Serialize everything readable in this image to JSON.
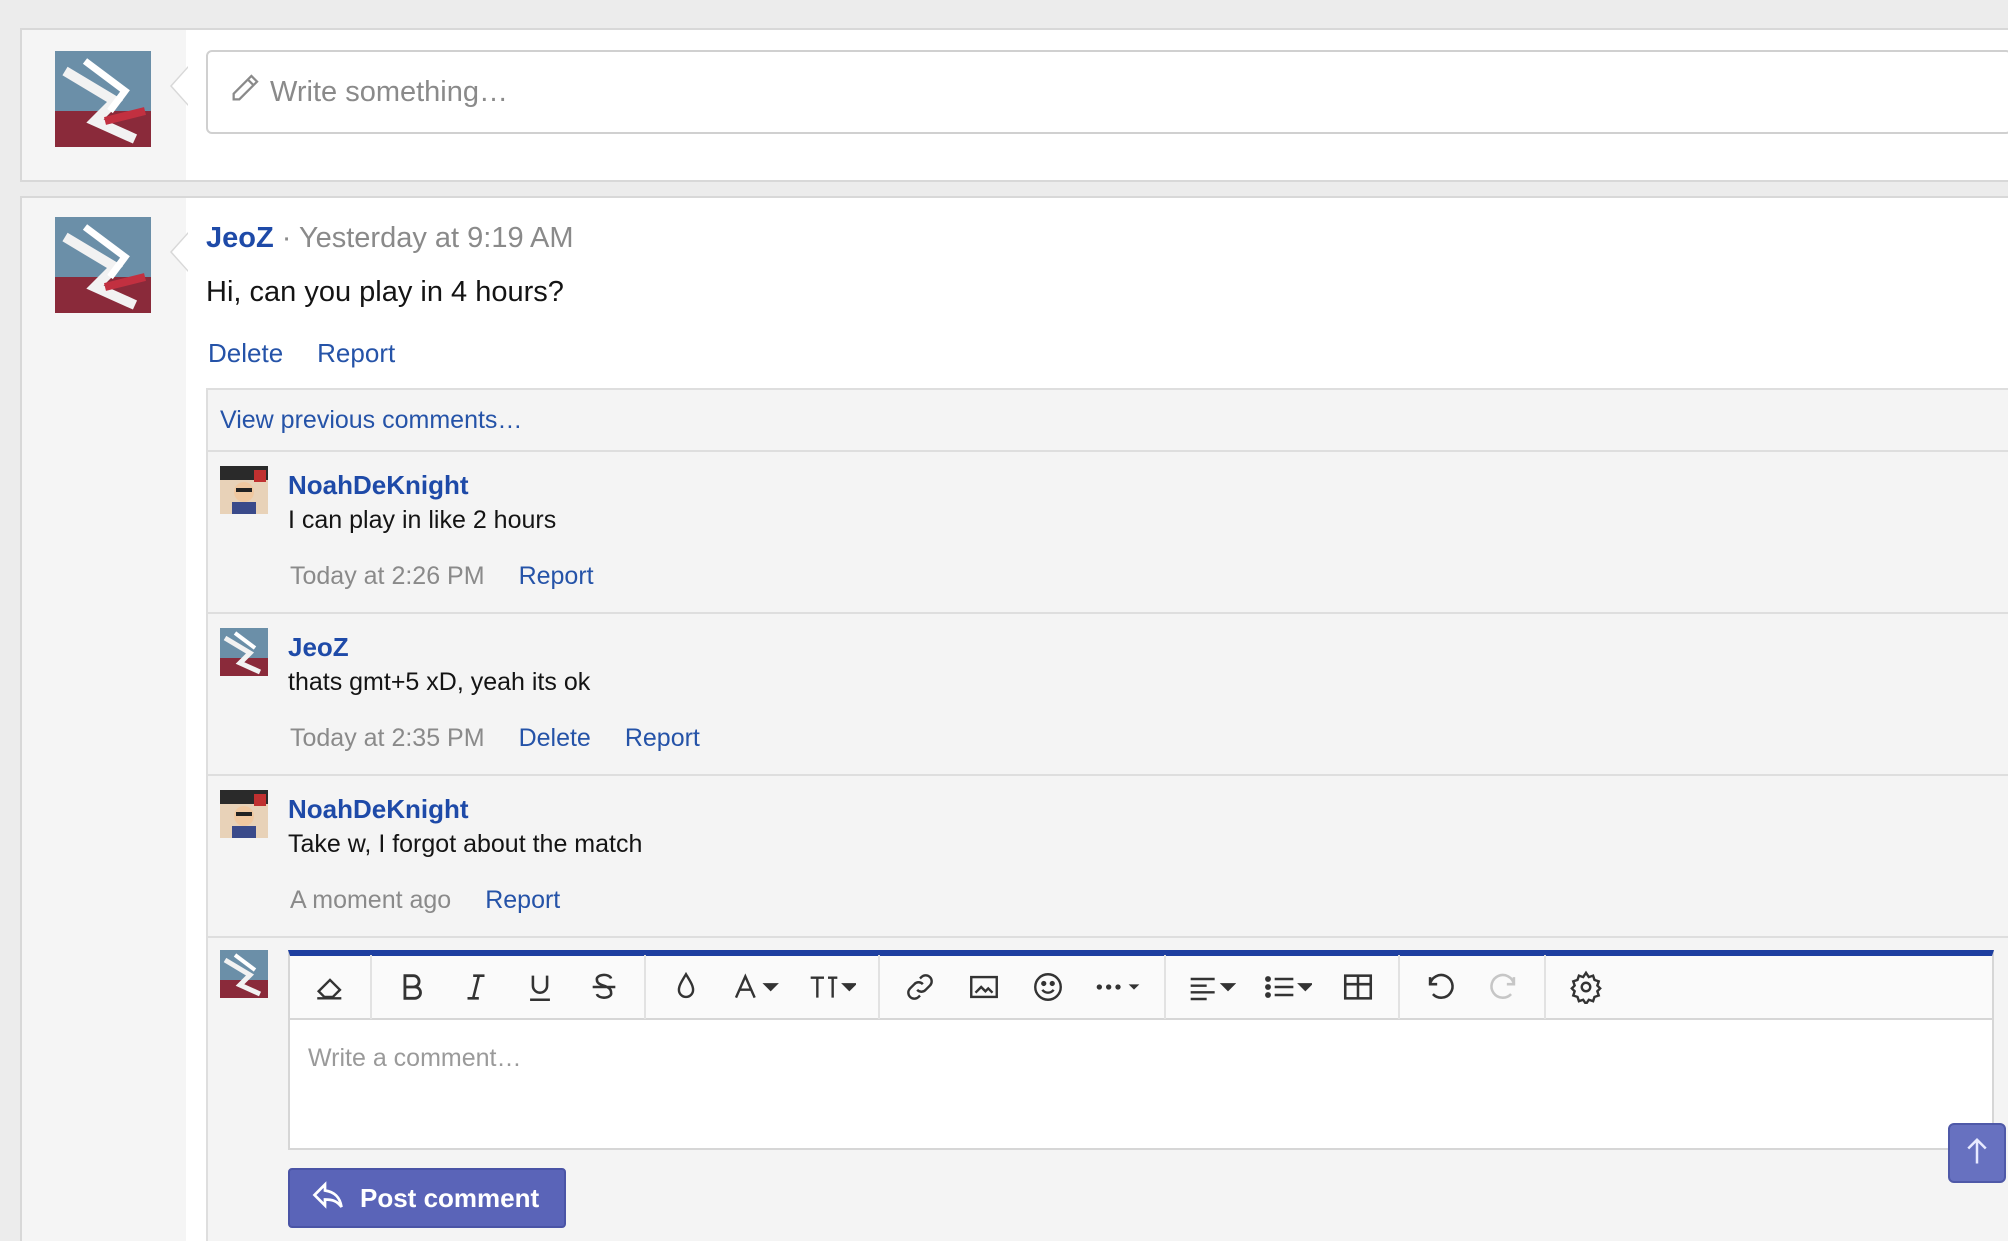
{
  "status_box": {
    "placeholder": "Write something…"
  },
  "post": {
    "author": "JeoZ",
    "separator": " · ",
    "time": "Yesterday at 9:19 AM",
    "body": "Hi, can you play in 4 hours?",
    "actions": {
      "delete": "Delete",
      "report": "Report"
    }
  },
  "comments": {
    "view_previous": "View previous comments…",
    "items": [
      {
        "author": "NoahDeKnight",
        "text": "I can play in like 2 hours",
        "time": "Today at 2:26 PM",
        "report": "Report"
      },
      {
        "author": "JeoZ",
        "text": "thats gmt+5 xD, yeah its ok",
        "time": "Today at 2:35 PM",
        "delete": "Delete",
        "report": "Report"
      },
      {
        "author": "NoahDeKnight",
        "text": "Take w, I forgot about the match",
        "time": "A moment ago",
        "report": "Report"
      }
    ]
  },
  "reply_editor": {
    "placeholder": "Write a comment…",
    "toolbar_icons": [
      "eraser-icon",
      "bold-icon",
      "italic-icon",
      "underline-icon",
      "strikethrough-icon",
      "text-color-icon",
      "font-family-icon",
      "font-size-icon",
      "link-icon",
      "image-icon",
      "smilie-icon",
      "more-options-icon",
      "align-icon",
      "list-icon",
      "table-icon",
      "undo-icon",
      "redo-icon",
      "settings-icon"
    ],
    "post_button": "Post comment"
  },
  "colors": {
    "link": "#2553a8",
    "accent_button": "#5a64b8",
    "editor_border": "#1e3fa0"
  }
}
